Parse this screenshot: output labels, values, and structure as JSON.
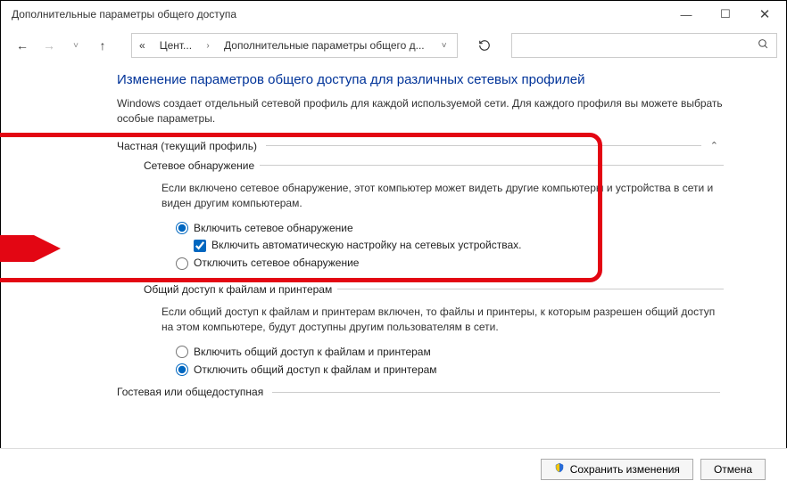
{
  "window": {
    "title": "Дополнительные параметры общего доступа"
  },
  "breadcrumb": {
    "prefix": "«",
    "seg1": "Цент...",
    "seg2": "Дополнительные параметры общего д..."
  },
  "heading": "Изменение параметров общего доступа для различных сетевых профилей",
  "intro": "Windows создает отдельный сетевой профиль для каждой используемой сети. Для каждого профиля вы можете выбрать особые параметры.",
  "sections": {
    "private": {
      "title": "Частная (текущий профиль)",
      "network_discovery": {
        "title": "Сетевое обнаружение",
        "desc": "Если включено сетевое обнаружение, этот компьютер может видеть другие компьютеры и устройства в сети и виден другим компьютерам.",
        "opt_on": "Включить сетевое обнаружение",
        "opt_auto": "Включить автоматическую настройку на сетевых устройствах.",
        "opt_off": "Отключить сетевое обнаружение"
      }
    },
    "sharing": {
      "title": "Общий доступ к файлам и принтерам",
      "desc": "Если общий доступ к файлам и принтерам включен, то файлы и принтеры, к которым разрешен общий доступ на этом компьютере, будут доступны другим пользователям в сети.",
      "opt_on": "Включить общий доступ к файлам и принтерам",
      "opt_off": "Отключить общий доступ к файлам и принтерам"
    },
    "guest": {
      "title": "Гостевая или общедоступная"
    }
  },
  "footer": {
    "save": "Сохранить изменения",
    "cancel": "Отмена"
  }
}
